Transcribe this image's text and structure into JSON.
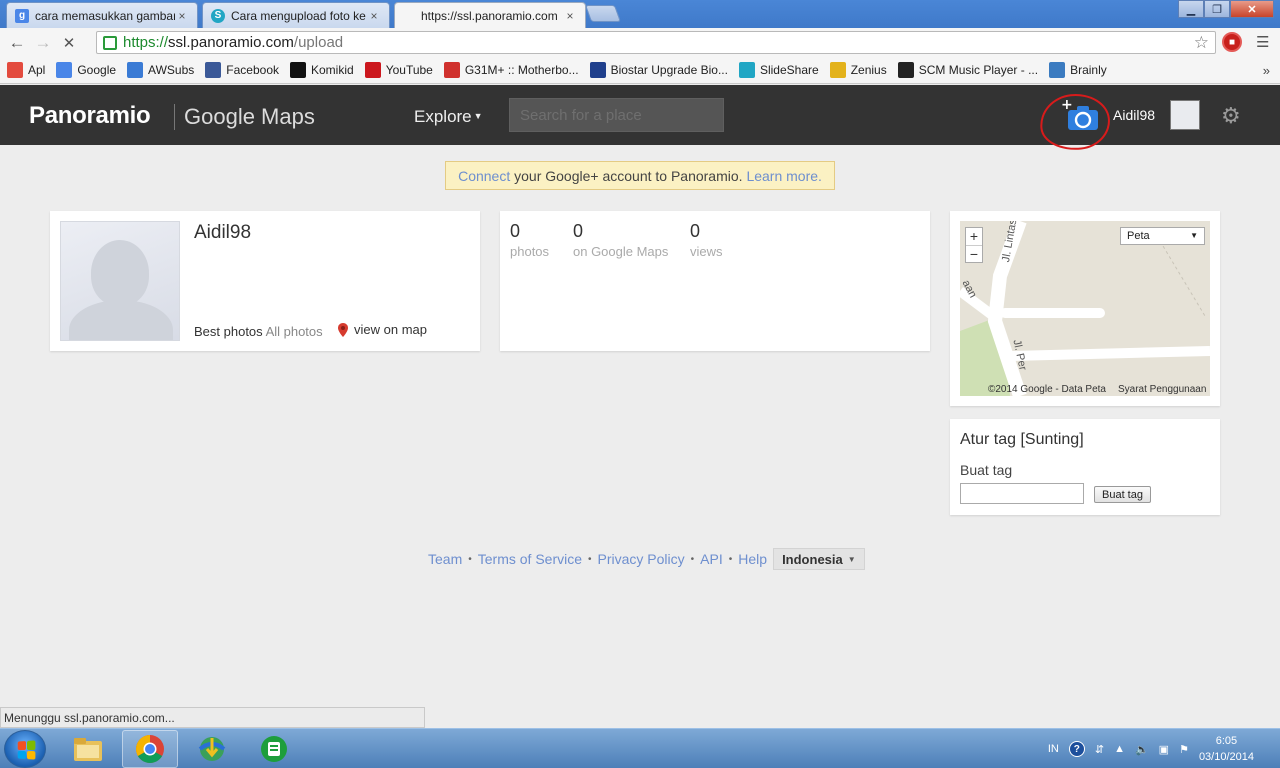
{
  "browser": {
    "tabs": [
      {
        "title": "cara memasukkan gambar",
        "icon": "google-g-icon"
      },
      {
        "title": "Cara mengupload foto ke",
        "icon": "slideshare-icon"
      },
      {
        "title": "https://ssl.panoramio.com",
        "icon": "loading-icon"
      }
    ],
    "close_glyph": "×",
    "url": {
      "scheme": "https://",
      "host": "ssl.panoramio.com",
      "path": "/upload"
    },
    "bookmarks": [
      {
        "label": "Apl",
        "icon": "apps-grid-icon",
        "color": "#e34b3e"
      },
      {
        "label": "Google",
        "icon": "google-g-icon",
        "color": "#4a86e8"
      },
      {
        "label": "AWSubs",
        "icon": "globe-icon",
        "color": "#3a7bd5"
      },
      {
        "label": "Facebook",
        "icon": "facebook-icon",
        "color": "#3b5998"
      },
      {
        "label": "Komikid",
        "icon": "komikid-icon",
        "color": "#111111"
      },
      {
        "label": "YouTube",
        "icon": "youtube-icon",
        "color": "#cc181e"
      },
      {
        "label": "G31M+ :: Motherbo...",
        "icon": "motherboard-icon",
        "color": "#d0312d"
      },
      {
        "label": "Biostar Upgrade Bio...",
        "icon": "biostar-icon",
        "color": "#1f3f8c"
      },
      {
        "label": "SlideShare",
        "icon": "slideshare-icon",
        "color": "#21a6c4"
      },
      {
        "label": "Zenius",
        "icon": "zenius-icon",
        "color": "#e3b21b"
      },
      {
        "label": "SCM Music Player - ...",
        "icon": "music-note-icon",
        "color": "#222222"
      },
      {
        "label": "Brainly",
        "icon": "brainly-icon",
        "color": "#3b7bc0"
      }
    ],
    "bookmarks_overflow": "»",
    "status_text": "Menunggu ssl.panoramio.com..."
  },
  "header": {
    "logo": "Panoramio",
    "logo_suffix": "Google Maps",
    "explore": "Explore",
    "search_placeholder": "Search for a place",
    "username": "Aidil98"
  },
  "notice": {
    "link1": "Connect",
    "text": " your Google+ account to Panoramio. ",
    "link2": "Learn more."
  },
  "profile": {
    "name": "Aidil98",
    "best_photos": "Best photos",
    "all_photos": "All photos",
    "view_on_map": "view on map"
  },
  "stats": [
    {
      "value": "0",
      "label": "photos"
    },
    {
      "value": "0",
      "label": "on Google Maps"
    },
    {
      "value": "0",
      "label": "views"
    }
  ],
  "map": {
    "zoom_in": "+",
    "zoom_out": "−",
    "type": "Peta",
    "attribution": "©2014 Google - Data Peta",
    "terms": "Syarat Penggunaan",
    "road1": "Jl. Lintas Sumat",
    "road2": "Jl. Per",
    "road3": "aan"
  },
  "tags": {
    "title": "Atur tag [Sunting]",
    "label": "Buat tag",
    "button": "Buat tag",
    "input_value": ""
  },
  "footer": {
    "links": [
      "Team",
      "Terms of Service",
      "Privacy Policy",
      "API",
      "Help"
    ],
    "separator": "•",
    "language": "Indonesia"
  },
  "taskbar": {
    "lang": "IN",
    "time": "6:05",
    "date": "03/10/2014"
  },
  "colors": {
    "link": "#6e8fcf",
    "header_bg": "#333333",
    "upload_blue": "#2f7fdf",
    "annotation_red": "#d81b1b"
  }
}
